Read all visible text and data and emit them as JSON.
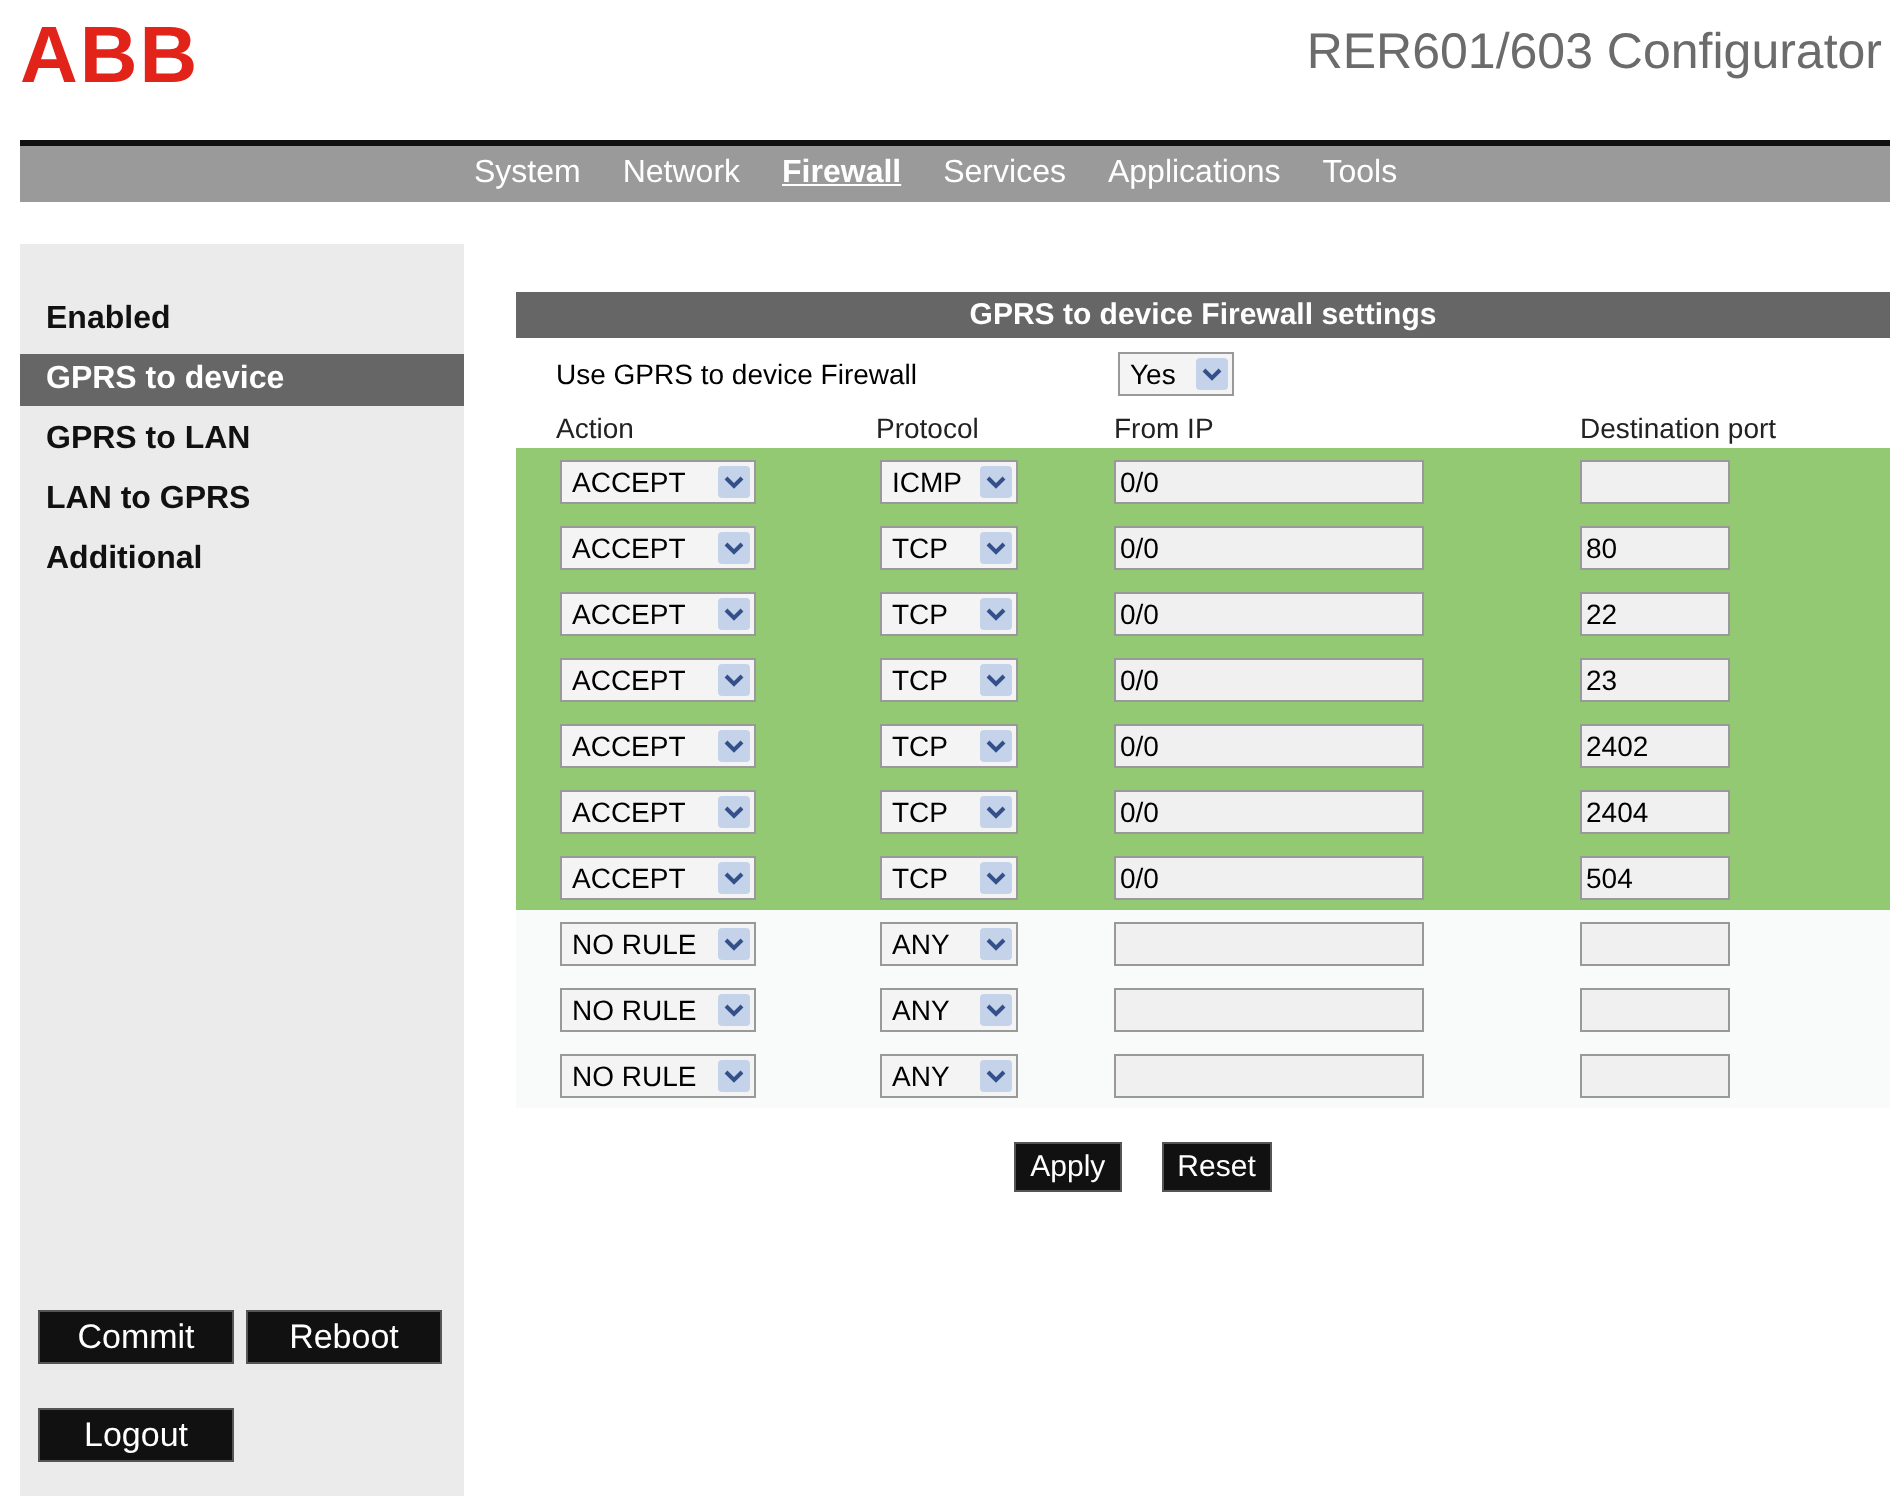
{
  "logo": "ABB",
  "app_title": "RER601/603 Configurator",
  "nav": [
    {
      "label": "System",
      "selected": false
    },
    {
      "label": "Network",
      "selected": false
    },
    {
      "label": "Firewall",
      "selected": true
    },
    {
      "label": "Services",
      "selected": false
    },
    {
      "label": "Applications",
      "selected": false
    },
    {
      "label": "Tools",
      "selected": false
    }
  ],
  "sidebar": {
    "items": [
      {
        "label": "Enabled",
        "selected": false
      },
      {
        "label": "GPRS to device",
        "selected": true
      },
      {
        "label": "GPRS to LAN",
        "selected": false
      },
      {
        "label": "LAN to GPRS",
        "selected": false
      },
      {
        "label": "Additional",
        "selected": false
      }
    ],
    "buttons": [
      "Commit",
      "Reboot"
    ],
    "logout": "Logout"
  },
  "panel": {
    "title": "GPRS to device Firewall settings",
    "use_label": "Use GPRS to device Firewall",
    "use_value": "Yes",
    "columns": [
      "Action",
      "Protocol",
      "From IP",
      "Destination port"
    ],
    "rows": [
      {
        "active": true,
        "action": "ACCEPT",
        "protocol": "ICMP",
        "from_ip": "0/0"
      },
      {
        "active": true,
        "action": "ACCEPT",
        "protocol": "TCP",
        "from_ip": "0/0",
        "port": "80"
      },
      {
        "active": true,
        "action": "ACCEPT",
        "protocol": "TCP",
        "from_ip": "0/0",
        "port": "22"
      },
      {
        "active": true,
        "action": "ACCEPT",
        "protocol": "TCP",
        "from_ip": "0/0",
        "port": "23"
      },
      {
        "active": true,
        "action": "ACCEPT",
        "protocol": "TCP",
        "from_ip": "0/0",
        "port": "2402"
      },
      {
        "active": true,
        "action": "ACCEPT",
        "protocol": "TCP",
        "from_ip": "0/0",
        "port": "2404"
      },
      {
        "active": true,
        "action": "ACCEPT",
        "protocol": "TCP",
        "from_ip": "0/0",
        "port": "504"
      },
      {
        "active": false,
        "action": "NO RULE",
        "protocol": "ANY"
      },
      {
        "active": false,
        "action": "NO RULE",
        "protocol": "ANY"
      },
      {
        "active": false,
        "action": "NO RULE",
        "protocol": "ANY"
      }
    ],
    "buttons": [
      "Apply",
      "Reset"
    ]
  }
}
